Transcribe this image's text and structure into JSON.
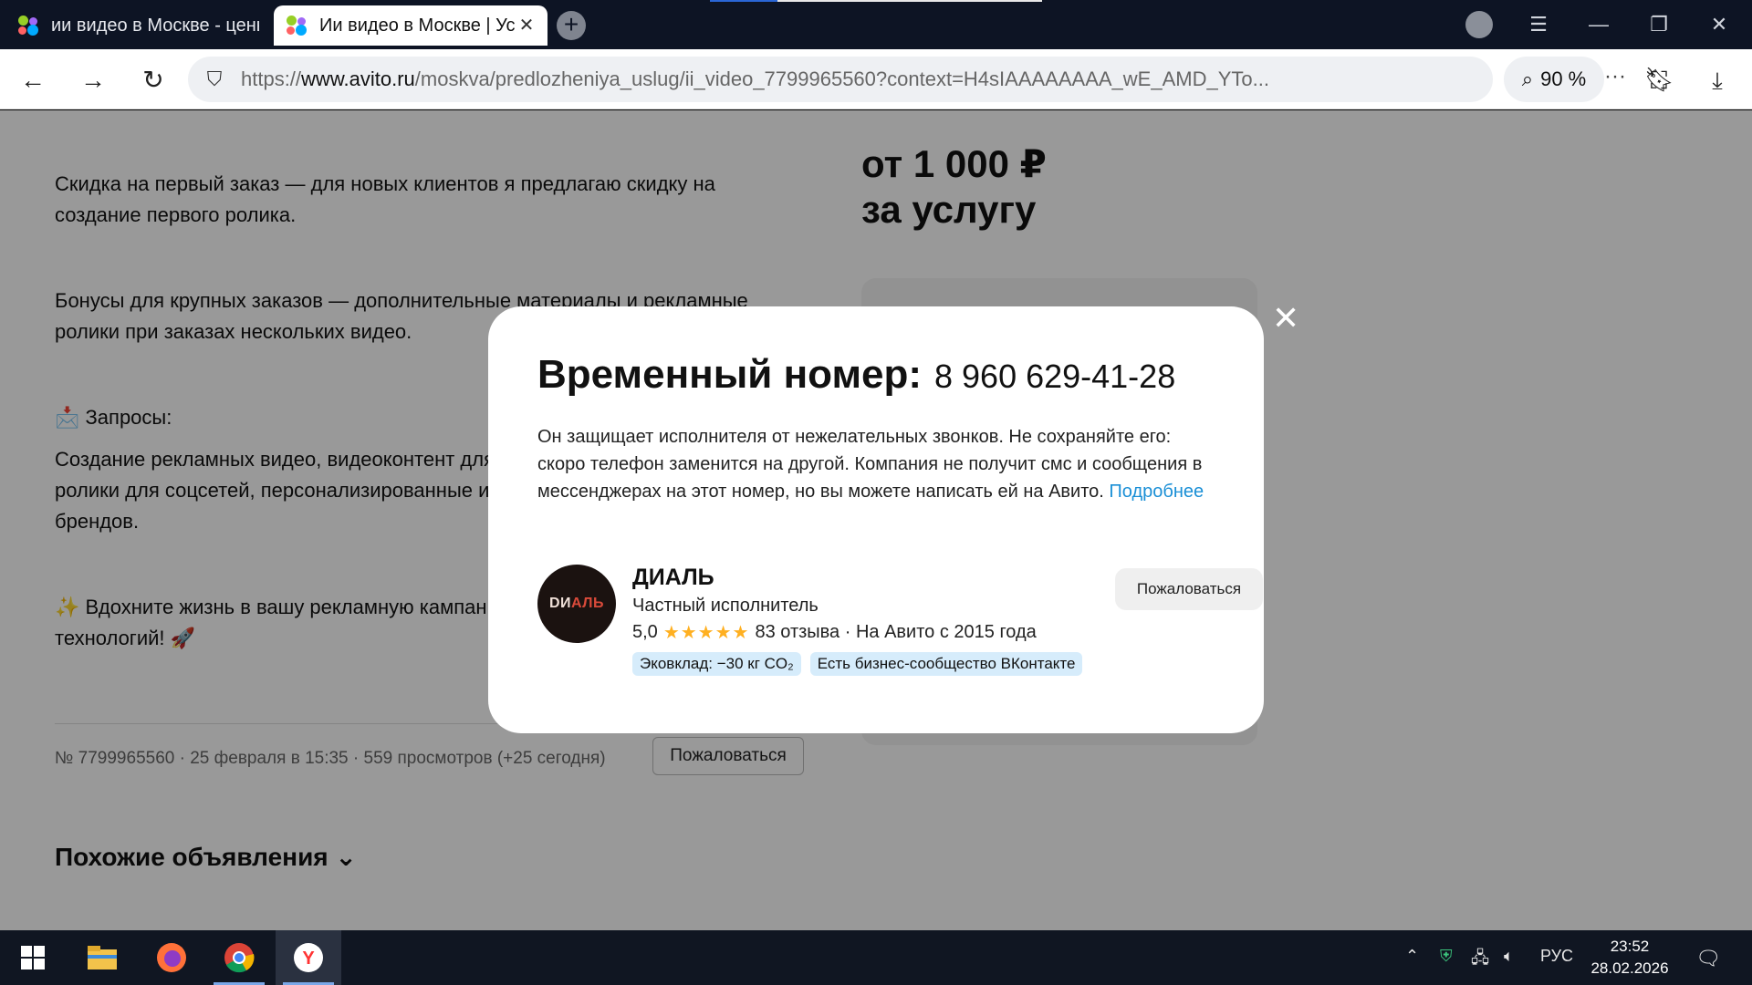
{
  "browser": {
    "tabs": [
      {
        "title": "ии видео в Москве - цены"
      },
      {
        "title": "Ии видео в Москве | Ус"
      }
    ],
    "url_prefix": "https://",
    "url_domain": "www.avito.ru",
    "url_path": "/moskva/predlozheniya_uslug/ii_video_7799965560?context=H4sIAAAAAAAA_wE_AMD_YTo...",
    "zoom": "90 %"
  },
  "listing": {
    "paragraphs": [
      "Скидка на первый заказ — для новых клиентов я предлагаю скидку на создание первого ролика.",
      "Бонусы для крупных заказов — дополнительные материалы и рекламные ролики при заказах нескольких видео.",
      "📩 Запросы:",
      "Создание рекламных видео, видеоконтент для бизнеса, видеопоздравления, ролики для соцсетей, персонализированные и креативные видеоролики для брендов.",
      "✨ Вдохните жизнь в вашу рекламную кампанию с помощью современных технологий! 🚀"
    ],
    "meta": "№ 7799965560 · 25 февраля в 15:35 · 559 просмотров (+25 сегодня)",
    "report_label": "Пожаловаться",
    "similar_heading": "Похожие объявления",
    "price_line1": "от 1 000 ₽",
    "price_line2": "за услугу"
  },
  "modal": {
    "title": "Временный номер:",
    "phone": "8 960 629-41-28",
    "description": "Он защищает исполнителя от нежелательных звонков. Не сохраняйте его: скоро телефон заменится на другой. Компания не получит смс и сообщения в мессенджерах на этот номер, но вы можете написать ей на Авито.",
    "more_link": "Подробнее",
    "seller": {
      "name": "ДИАЛЬ",
      "avatar_text_a": "DИ",
      "avatar_text_b": "АЛЬ",
      "type": "Частный исполнитель",
      "rating": "5,0",
      "stars": "★★★★★",
      "reviews": "83 отзыва · На Авито с 2015 года",
      "badges": [
        "Эковклад: −30 кг CO₂",
        "Есть бизнес-сообщество ВКонтакте"
      ]
    },
    "report_label": "Пожаловаться"
  },
  "taskbar": {
    "language": "РУС",
    "time": "23:52",
    "date": "28.02.2026"
  }
}
